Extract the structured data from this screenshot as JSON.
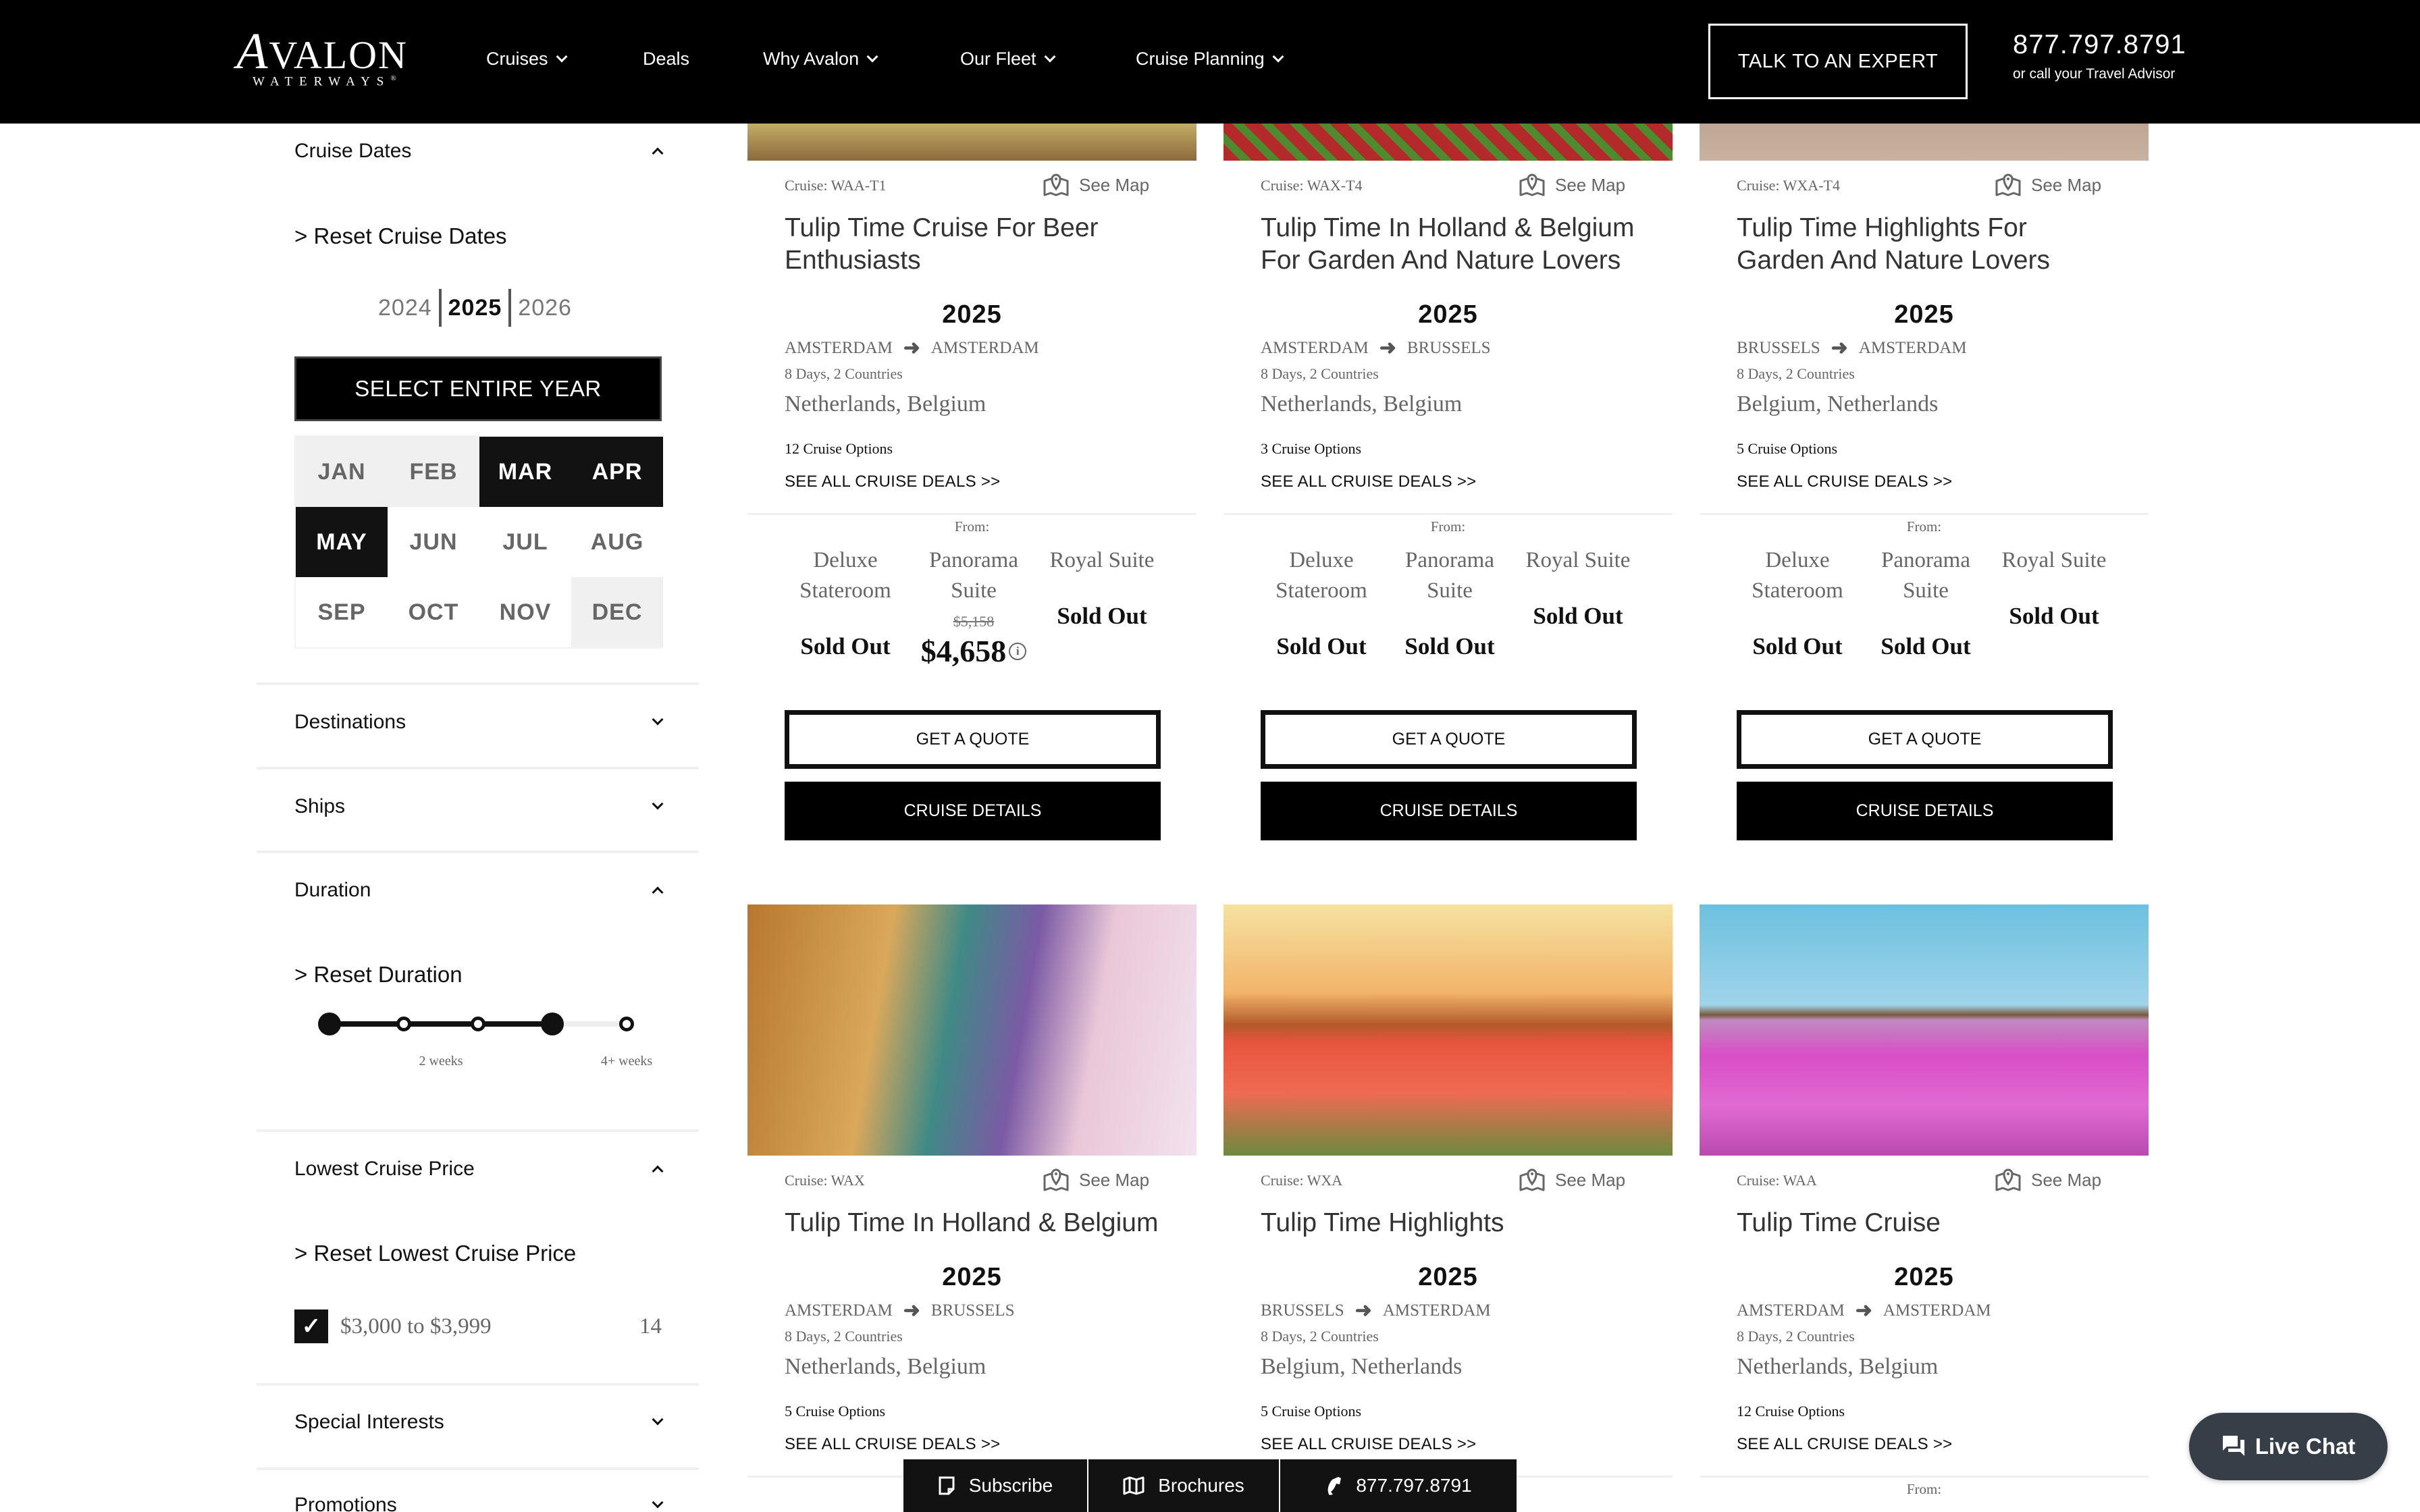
{
  "header": {
    "logo": {
      "main": "AVALON",
      "sub": "WATERWAYS",
      "registered": "®"
    },
    "nav": [
      {
        "label": "Cruises",
        "has_dropdown": true
      },
      {
        "label": "Deals",
        "has_dropdown": false
      },
      {
        "label": "Why Avalon",
        "has_dropdown": true
      },
      {
        "label": "Our Fleet",
        "has_dropdown": true
      },
      {
        "label": "Cruise Planning",
        "has_dropdown": true
      }
    ],
    "cta_label": "TALK TO AN EXPERT",
    "phone": "877.797.8791",
    "phone_sub": "or call your Travel Advisor"
  },
  "sidebar": {
    "cruise_dates": {
      "title": "Cruise Dates",
      "expanded": true,
      "reset_label": "> Reset Cruise Dates",
      "years": [
        {
          "label": "2024",
          "active": false
        },
        {
          "label": "2025",
          "active": true
        },
        {
          "label": "2026",
          "active": false
        }
      ],
      "select_year_label": "SELECT ENTIRE YEAR",
      "months": [
        {
          "label": "JAN",
          "state": "unavailable"
        },
        {
          "label": "FEB",
          "state": "unavailable"
        },
        {
          "label": "MAR",
          "state": "selected"
        },
        {
          "label": "APR",
          "state": "selected"
        },
        {
          "label": "MAY",
          "state": "selected"
        },
        {
          "label": "JUN",
          "state": "available"
        },
        {
          "label": "JUL",
          "state": "available"
        },
        {
          "label": "AUG",
          "state": "available"
        },
        {
          "label": "SEP",
          "state": "available"
        },
        {
          "label": "OCT",
          "state": "available"
        },
        {
          "label": "NOV",
          "state": "available"
        },
        {
          "label": "DEC",
          "state": "unavailable"
        }
      ]
    },
    "destinations": {
      "title": "Destinations",
      "expanded": false
    },
    "ships": {
      "title": "Ships",
      "expanded": false
    },
    "duration": {
      "title": "Duration",
      "expanded": true,
      "reset_label": "> Reset Duration",
      "steps": 5,
      "selected_range": [
        0,
        3
      ],
      "labels": [
        {
          "text": "2 weeks",
          "step": 1.5
        },
        {
          "text": "4+ weeks",
          "step": 4
        }
      ]
    },
    "lowest_price": {
      "title": "Lowest Cruise Price",
      "expanded": true,
      "reset_label": "> Reset Lowest Cruise Price",
      "options": [
        {
          "label": "$3,000 to $3,999",
          "count": "14",
          "checked": true
        }
      ]
    },
    "special_interests": {
      "title": "Special Interests",
      "expanded": false
    },
    "promotions": {
      "title": "Promotions",
      "expanded": false
    }
  },
  "cards": [
    {
      "code": "Cruise: WAA-T1",
      "map_label": "See Map",
      "title": "Tulip Time Cruise For Beer Enthusiasts",
      "year": "2025",
      "from_city": "AMSTERDAM",
      "to_city": "AMSTERDAM",
      "days": "8 Days, 2 Countries",
      "countries": "Netherlands, Belgium",
      "options": "12 Cruise Options",
      "deals_label": "SEE ALL CRUISE DEALS >>",
      "from_label": "From:",
      "cabins": [
        {
          "name": "Deluxe Stateroom",
          "price": "Sold Out",
          "old_price": ""
        },
        {
          "name": "Panorama Suite",
          "price": "$4,658",
          "old_price": "$5,158",
          "info": true
        },
        {
          "name": "Royal Suite",
          "price": "Sold Out",
          "old_price": ""
        }
      ],
      "quote_label": "GET A QUOTE",
      "details_label": "CRUISE DETAILS",
      "image": "bicycle-canal"
    },
    {
      "code": "Cruise: WAX-T4",
      "map_label": "See Map",
      "title": "Tulip Time In Holland & Belgium For Garden And Nature Lovers",
      "year": "2025",
      "from_city": "AMSTERDAM",
      "to_city": "BRUSSELS",
      "days": "8 Days, 2 Countries",
      "countries": "Netherlands, Belgium",
      "options": "3 Cruise Options",
      "deals_label": "SEE ALL CRUISE DEALS >>",
      "from_label": "From:",
      "cabins": [
        {
          "name": "Deluxe Stateroom",
          "price": "Sold Out",
          "old_price": ""
        },
        {
          "name": "Panorama Suite",
          "price": "Sold Out",
          "old_price": ""
        },
        {
          "name": "Royal Suite",
          "price": "Sold Out",
          "old_price": ""
        }
      ],
      "quote_label": "GET A QUOTE",
      "details_label": "CRUISE DETAILS",
      "image": "formal-garden"
    },
    {
      "code": "Cruise: WXA-T4",
      "map_label": "See Map",
      "title": "Tulip Time Highlights For Garden And Nature Lovers",
      "year": "2025",
      "from_city": "BRUSSELS",
      "to_city": "AMSTERDAM",
      "days": "8 Days, 2 Countries",
      "countries": "Belgium, Netherlands",
      "options": "5 Cruise Options",
      "deals_label": "SEE ALL CRUISE DEALS >>",
      "from_label": "From:",
      "cabins": [
        {
          "name": "Deluxe Stateroom",
          "price": "Sold Out",
          "old_price": ""
        },
        {
          "name": "Panorama Suite",
          "price": "Sold Out",
          "old_price": ""
        },
        {
          "name": "Royal Suite",
          "price": "Sold Out",
          "old_price": ""
        }
      ],
      "quote_label": "GET A QUOTE",
      "details_label": "CRUISE DETAILS",
      "image": "old-town-street"
    },
    {
      "code": "Cruise: WAX",
      "map_label": "See Map",
      "title": "Tulip Time In Holland & Belgium",
      "year": "2025",
      "from_city": "AMSTERDAM",
      "to_city": "BRUSSELS",
      "days": "8 Days, 2 Countries",
      "countries": "Netherlands, Belgium",
      "options": "5 Cruise Options",
      "deals_label": "SEE ALL CRUISE DEALS >>",
      "image": "antwerp-brabo-fountain"
    },
    {
      "code": "Cruise: WXA",
      "map_label": "See Map",
      "title": "Tulip Time Highlights",
      "year": "2025",
      "from_city": "BRUSSELS",
      "to_city": "AMSTERDAM",
      "days": "8 Days, 2 Countries",
      "countries": "Belgium, Netherlands",
      "options": "5 Cruise Options",
      "deals_label": "SEE ALL CRUISE DEALS >>",
      "image": "windmills-red-tulips"
    },
    {
      "code": "Cruise: WAA",
      "map_label": "See Map",
      "title": "Tulip Time Cruise",
      "year": "2025",
      "from_city": "AMSTERDAM",
      "to_city": "AMSTERDAM",
      "days": "8 Days, 2 Countries",
      "countries": "Netherlands, Belgium",
      "options": "12 Cruise Options",
      "deals_label": "SEE ALL CRUISE DEALS >>",
      "from_label": "From:",
      "image": "windmills-pink-tulips"
    }
  ],
  "bottom_bar": {
    "subscribe": "Subscribe",
    "brochures": "Brochures",
    "phone": "877.797.8791"
  },
  "live_chat": {
    "label": "Live Chat"
  }
}
